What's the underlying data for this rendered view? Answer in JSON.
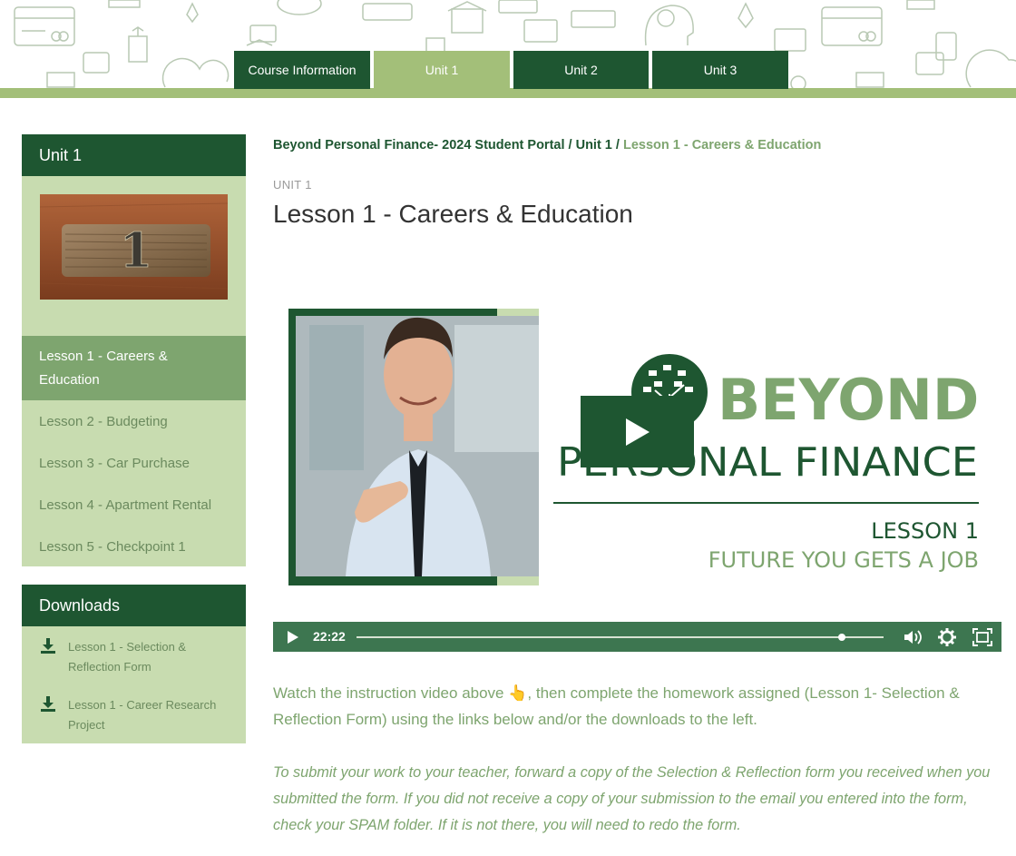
{
  "tabs": [
    {
      "label": "Course Information",
      "active": false
    },
    {
      "label": "Unit 1",
      "active": true
    },
    {
      "label": "Unit 2",
      "active": false
    },
    {
      "label": "Unit 3",
      "active": false
    }
  ],
  "sidebar": {
    "unit_title": "Unit 1",
    "lessons": [
      {
        "label": "Lesson 1 - Careers & Education",
        "active": true
      },
      {
        "label": "Lesson 2 - Budgeting"
      },
      {
        "label": "Lesson 3 - Car Purchase"
      },
      {
        "label": "Lesson 4 - Apartment Rental"
      },
      {
        "label": "Lesson 5 - Checkpoint 1"
      }
    ],
    "downloads_title": "Downloads",
    "downloads": [
      {
        "label": "Lesson 1 - Selection & Reflection Form"
      },
      {
        "label": "Lesson 1 - Career Research Project"
      }
    ],
    "unit_image_number": "1"
  },
  "breadcrumb": {
    "root": "Beyond Personal Finance- 2024 Student Portal",
    "separator": "/",
    "unit": "Unit 1",
    "current": "Lesson 1 - Careers & Education"
  },
  "eyebrow": "UNIT 1",
  "title": "Lesson 1 - Careers & Education",
  "video": {
    "brand_line1": "BEYOND",
    "brand_line2": "PERSONAL FINANCE",
    "lesson_label": "LESSON 1",
    "subtitle": "FUTURE YOU GETS A JOB",
    "time": "22:22",
    "progress": 0.92
  },
  "instructions": {
    "before_emoji": "Watch the instruction video above ",
    "emoji": "👆",
    "after_emoji": ", then complete the homework assigned (Lesson 1- Selection & Reflection Form) using the links below and/or the downloads to the left."
  },
  "submit_note": "To submit your work to your teacher, forward a copy of the Selection & Reflection form you received when you submitted the form.  If you did not receive a copy of your submission to the email you entered into the form, check your SPAM folder.  If it is not there, you will need to redo the form.",
  "colors": {
    "dark_green": "#1e5631",
    "light_green": "#a3bf79",
    "pale_green": "#c8dcb0",
    "mid_green": "#7ea56f",
    "control_bar": "#3d7650"
  }
}
